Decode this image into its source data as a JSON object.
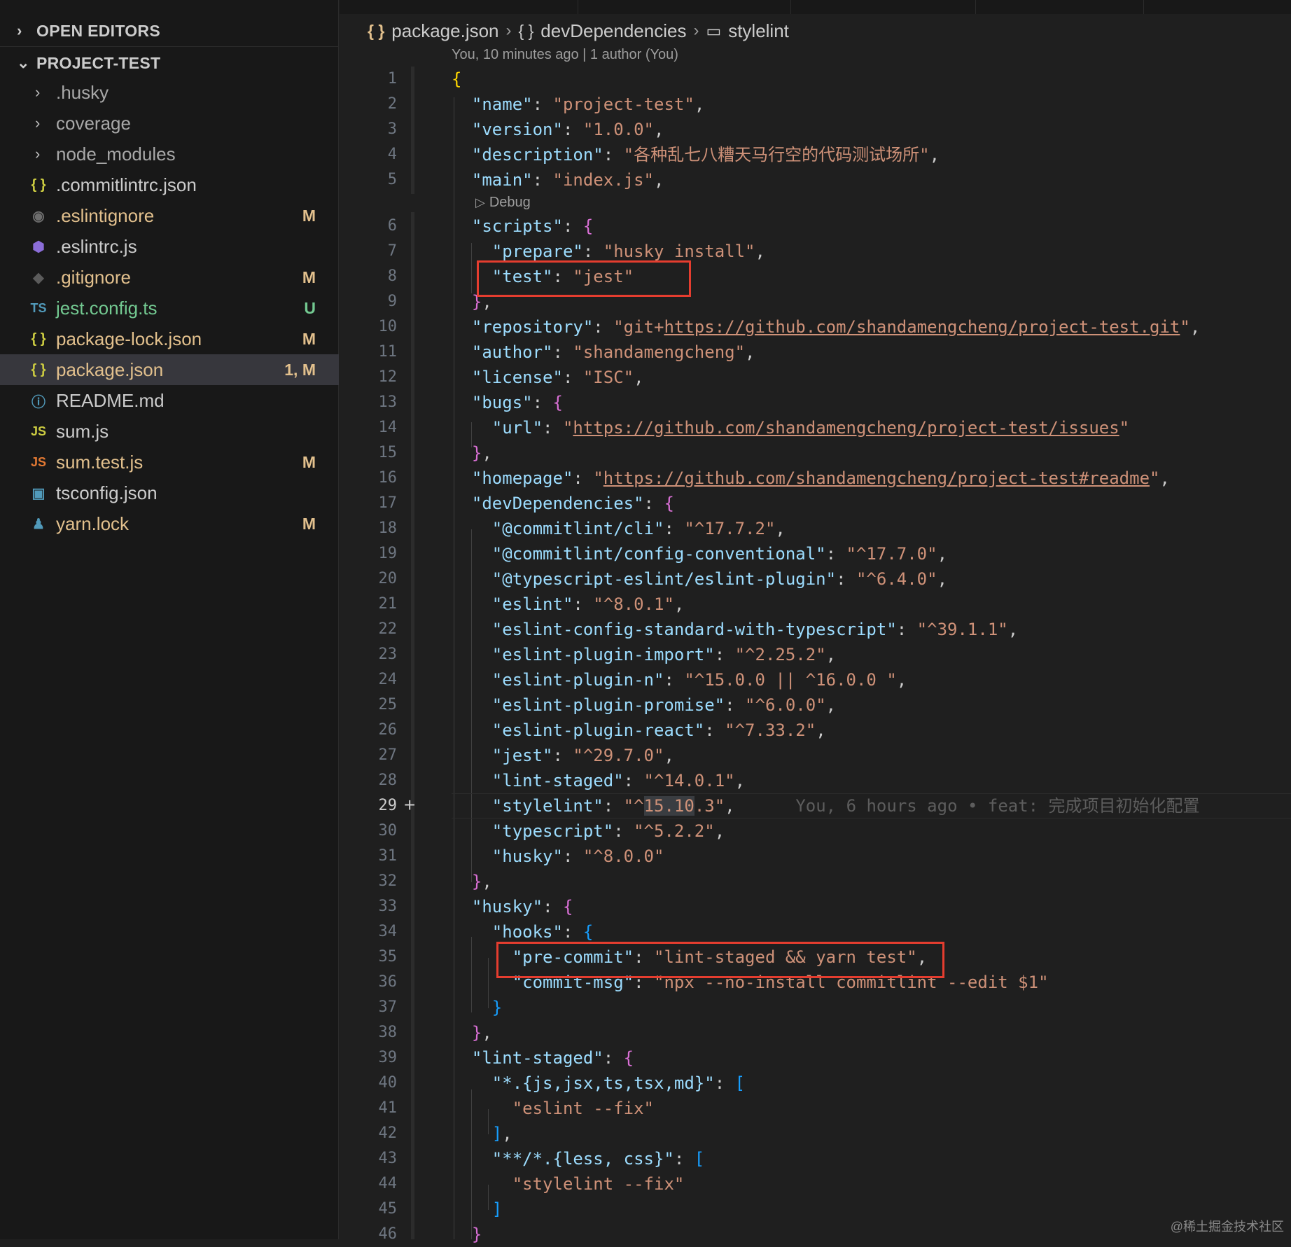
{
  "explorer": {
    "open_editors_label": "OPEN EDITORS",
    "project_label": "PROJECT-TEST",
    "items": [
      {
        "name": ".husky",
        "type": "folder",
        "status": ""
      },
      {
        "name": "coverage",
        "type": "folder",
        "status": ""
      },
      {
        "name": "node_modules",
        "type": "folder",
        "status": ""
      },
      {
        "name": ".commitlintrc.json",
        "type": "json",
        "status": ""
      },
      {
        "name": ".eslintignore",
        "type": "ignore",
        "status": "M"
      },
      {
        "name": ".eslintrc.js",
        "type": "eslint",
        "status": ""
      },
      {
        "name": ".gitignore",
        "type": "git",
        "status": "M"
      },
      {
        "name": "jest.config.ts",
        "type": "ts",
        "status": "U"
      },
      {
        "name": "package-lock.json",
        "type": "json",
        "status": "M"
      },
      {
        "name": "package.json",
        "type": "json",
        "status": "1, M"
      },
      {
        "name": "README.md",
        "type": "info",
        "status": ""
      },
      {
        "name": "sum.js",
        "type": "js",
        "status": ""
      },
      {
        "name": "sum.test.js",
        "type": "js",
        "status": "M"
      },
      {
        "name": "tsconfig.json",
        "type": "tsconfig",
        "status": ""
      },
      {
        "name": "yarn.lock",
        "type": "yarn",
        "status": "M"
      }
    ],
    "icons": {
      "json": "{ }",
      "ignore": "◉",
      "eslint": "⬢",
      "git": "◆",
      "ts": "TS",
      "info": "ⓘ",
      "js": "JS",
      "tsconfig": "▣",
      "yarn": "♟"
    }
  },
  "breadcrumb": {
    "file": "package.json",
    "object": "devDependencies",
    "key": "stylelint",
    "file_icon": "{ }",
    "object_icon": "{ }",
    "key_icon": "▭"
  },
  "editor": {
    "blame_header": "You, 10 minutes ago | 1 author (You)",
    "codelens": "Debug",
    "current_line": "29",
    "inline_blame": "You, 6 hours ago • feat: 完成项目初始化配置",
    "line_numbers": [
      "1",
      "2",
      "3",
      "4",
      "5",
      "6",
      "7",
      "8",
      "9",
      "10",
      "11",
      "12",
      "13",
      "14",
      "15",
      "16",
      "17",
      "18",
      "19",
      "20",
      "21",
      "22",
      "23",
      "24",
      "25",
      "26",
      "27",
      "28",
      "29",
      "30",
      "31",
      "32",
      "33",
      "34",
      "35",
      "36",
      "37",
      "38",
      "39",
      "40",
      "41",
      "42",
      "43",
      "44",
      "45",
      "46"
    ]
  },
  "code": {
    "l2": [
      "\"name\"",
      "\"project-test\""
    ],
    "l3": [
      "\"version\"",
      "\"1.0.0\""
    ],
    "l4": [
      "\"description\"",
      "\"各种乱七八糟天马行空的代码测试场所\""
    ],
    "l5": [
      "\"main\"",
      "\"index.js\""
    ],
    "l6": [
      "\"scripts\""
    ],
    "l7": [
      "\"prepare\"",
      "\"husky install\""
    ],
    "l8": [
      "\"test\"",
      "\"jest\""
    ],
    "l10": [
      "\"repository\"",
      "\"git+",
      "https://github.com/shandamengcheng/project-test.git",
      "\""
    ],
    "l11": [
      "\"author\"",
      "\"shandamengcheng\""
    ],
    "l12": [
      "\"license\"",
      "\"ISC\""
    ],
    "l13": [
      "\"bugs\""
    ],
    "l14": [
      "\"url\"",
      "\"",
      "https://github.com/shandamengcheng/project-test/issues",
      "\""
    ],
    "l16": [
      "\"homepage\"",
      "\"",
      "https://github.com/shandamengcheng/project-test#readme",
      "\""
    ],
    "l17": [
      "\"devDependencies\""
    ],
    "l18": [
      "\"@commitlint/cli\"",
      "\"^17.7.2\""
    ],
    "l19": [
      "\"@commitlint/config-conventional\"",
      "\"^17.7.0\""
    ],
    "l20": [
      "\"@typescript-eslint/eslint-plugin\"",
      "\"^6.4.0\""
    ],
    "l21": [
      "\"eslint\"",
      "\"^8.0.1\""
    ],
    "l22": [
      "\"eslint-config-standard-with-typescript\"",
      "\"^39.1.1\""
    ],
    "l23": [
      "\"eslint-plugin-import\"",
      "\"^2.25.2\""
    ],
    "l24": [
      "\"eslint-plugin-n\"",
      "\"^15.0.0 || ^16.0.0 \""
    ],
    "l25": [
      "\"eslint-plugin-promise\"",
      "\"^6.0.0\""
    ],
    "l26": [
      "\"eslint-plugin-react\"",
      "\"^7.33.2\""
    ],
    "l27": [
      "\"jest\"",
      "\"^29.7.0\""
    ],
    "l28": [
      "\"lint-staged\"",
      "\"^14.0.1\""
    ],
    "l29": [
      "\"stylelint\"",
      "\"^",
      "15.10",
      ".3\""
    ],
    "l30": [
      "\"typescript\"",
      "\"^5.2.2\""
    ],
    "l31": [
      "\"husky\"",
      "\"^8.0.0\""
    ],
    "l33": [
      "\"husky\""
    ],
    "l34": [
      "\"hooks\""
    ],
    "l35": [
      "\"pre-commit\"",
      "\"lint-staged && yarn test\""
    ],
    "l36": [
      "\"commit-msg\"",
      "\"npx --no-install commitlint --edit $1\""
    ],
    "l39": [
      "\"lint-staged\""
    ],
    "l40": [
      "\"*.{js,jsx,ts,tsx,md}\""
    ],
    "l41": [
      "\"eslint --fix\""
    ],
    "l43": [
      "\"**/*.{less, css}\""
    ],
    "l44": [
      "\"stylelint --fix\""
    ]
  },
  "watermark": "@稀土掘金技术社区",
  "colors": {
    "modified": "#e2c08d",
    "untracked": "#73c991",
    "highlight_box": "#e53d2f",
    "json_key": "#9cdcfe",
    "json_string": "#ce9178"
  }
}
